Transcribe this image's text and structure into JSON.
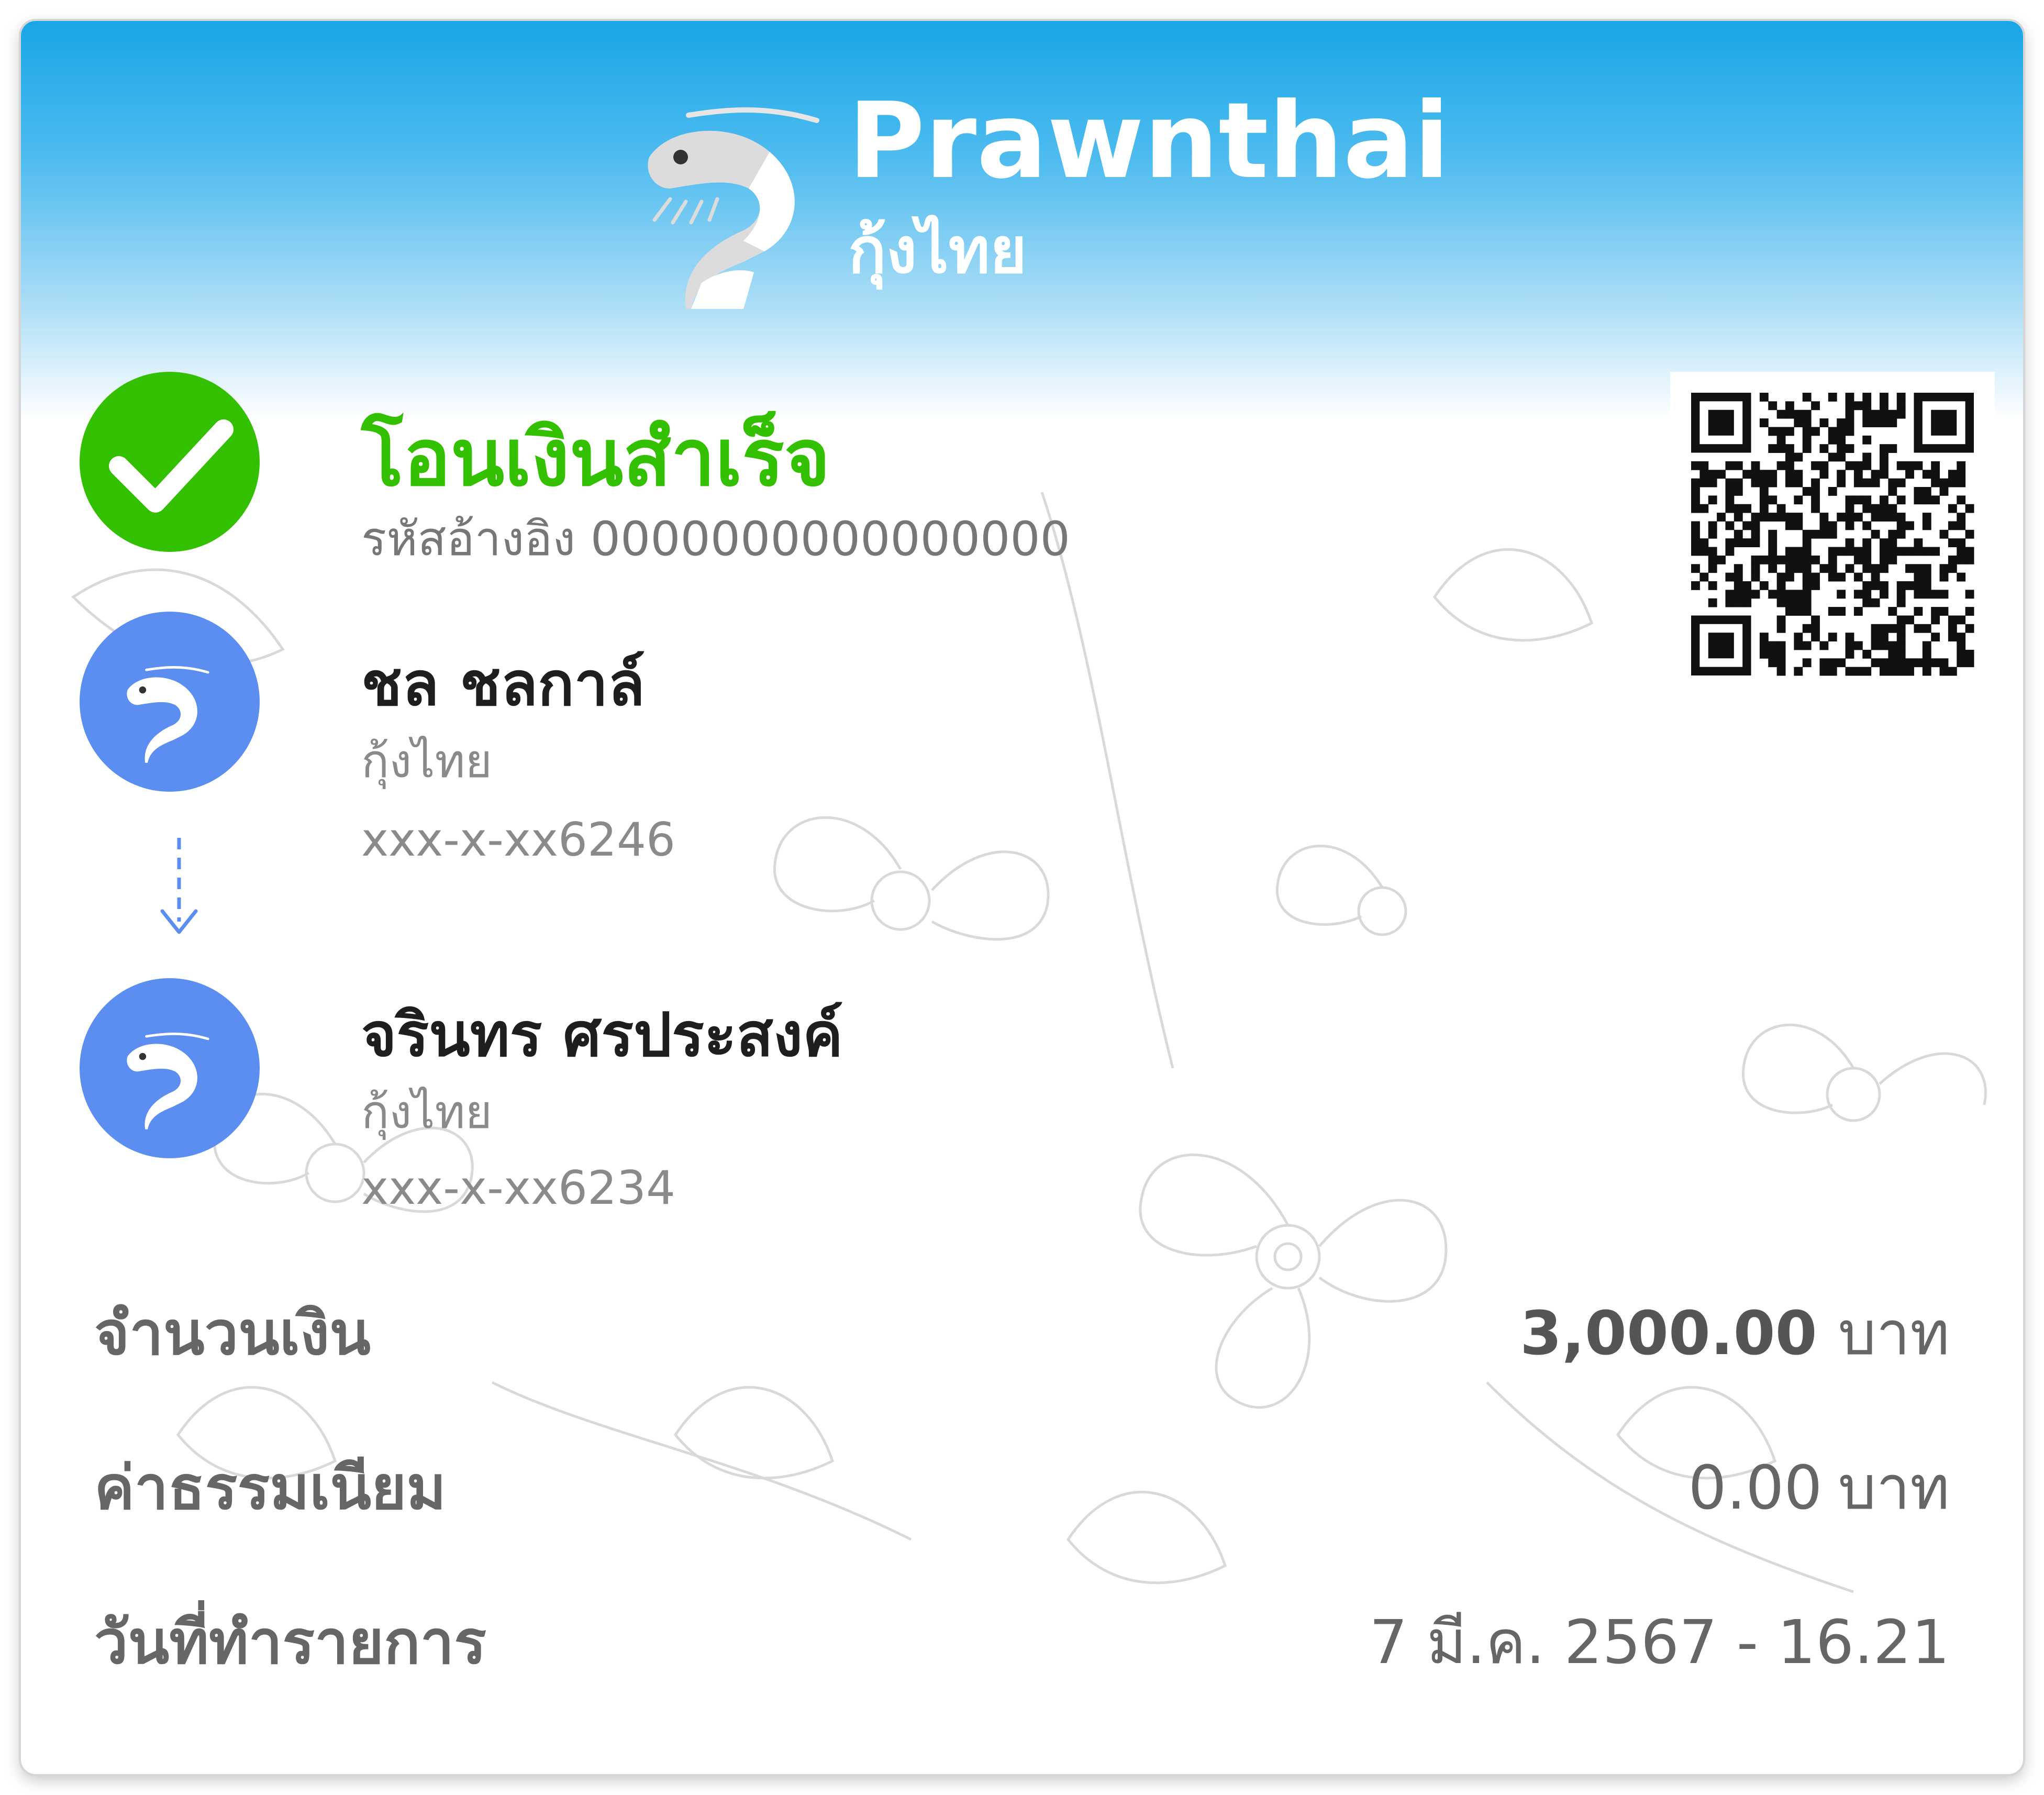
{
  "brand": {
    "name": "Prawnthai",
    "subtitle": "กุ้งไทย",
    "header_color": "#18a6e6"
  },
  "status": {
    "title": "โอนเงินสำเร็จ",
    "ref_label": "รหัสอ้างอิง",
    "ref_value": "0000000000000000",
    "icon": "check-circle-icon",
    "color": "#33c000"
  },
  "sender": {
    "name": "ชล ชลกาล์",
    "bank": "กุ้งไทย",
    "account": "xxx-x-xx6246",
    "icon": "prawn-bank-icon"
  },
  "receiver": {
    "name": "จรินทร ศรประสงค์",
    "bank": "กุ้งไทย",
    "account": "xxx-x-xx6234",
    "icon": "prawn-bank-icon"
  },
  "details": {
    "amount_label": "จำนวนเงิน",
    "amount_value": "3,000.00",
    "amount_unit": "บาท",
    "fee_label": "ค่าธรรมเนียม",
    "fee_value": "0.00",
    "fee_unit": "บาท",
    "date_label": "วันที่ทำรายการ",
    "date_value": "7 มี.ค. 2567 - 16.21"
  },
  "accent_blue": "#5b8ef0"
}
